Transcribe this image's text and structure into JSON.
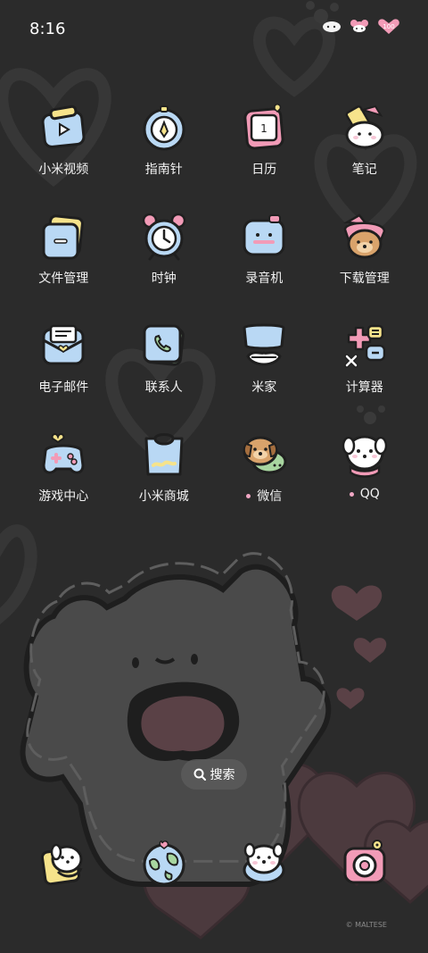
{
  "status_bar": {
    "time": "8:16",
    "icons": [
      "sheep-badge-icon",
      "flower-badge-icon",
      "heart-100-badge-icon"
    ]
  },
  "apps": [
    {
      "label": "小米视频",
      "icon": "video-icon"
    },
    {
      "label": "指南针",
      "icon": "compass-icon"
    },
    {
      "label": "日历",
      "icon": "calendar-icon"
    },
    {
      "label": "笔记",
      "icon": "notes-icon"
    },
    {
      "label": "文件管理",
      "icon": "file-manager-icon"
    },
    {
      "label": "时钟",
      "icon": "alarm-clock-icon"
    },
    {
      "label": "录音机",
      "icon": "recorder-icon"
    },
    {
      "label": "下载管理",
      "icon": "download-puppy-icon"
    },
    {
      "label": "电子邮件",
      "icon": "email-icon"
    },
    {
      "label": "联系人",
      "icon": "contacts-icon"
    },
    {
      "label": "米家",
      "icon": "mijia-icon"
    },
    {
      "label": "计算器",
      "icon": "calculator-icon"
    },
    {
      "label": "游戏中心",
      "icon": "gamepad-icon"
    },
    {
      "label": "小米商城",
      "icon": "shopping-bag-icon"
    },
    {
      "label": "微信",
      "icon": "wechat-puppy-icon",
      "notify": true
    },
    {
      "label": "QQ",
      "icon": "qq-puppy-icon",
      "notify": true
    }
  ],
  "search": {
    "label": "搜索"
  },
  "dock": [
    {
      "icon": "phone-puppy-icon"
    },
    {
      "icon": "browser-globe-icon"
    },
    {
      "icon": "messages-puppy-icon"
    },
    {
      "icon": "camera-icon"
    }
  ],
  "watermark": "© MALTESE",
  "colors": {
    "background": "#2b2b2b",
    "accent_pink": "#f0a7c4",
    "icon_blue": "#b9d8f4"
  }
}
